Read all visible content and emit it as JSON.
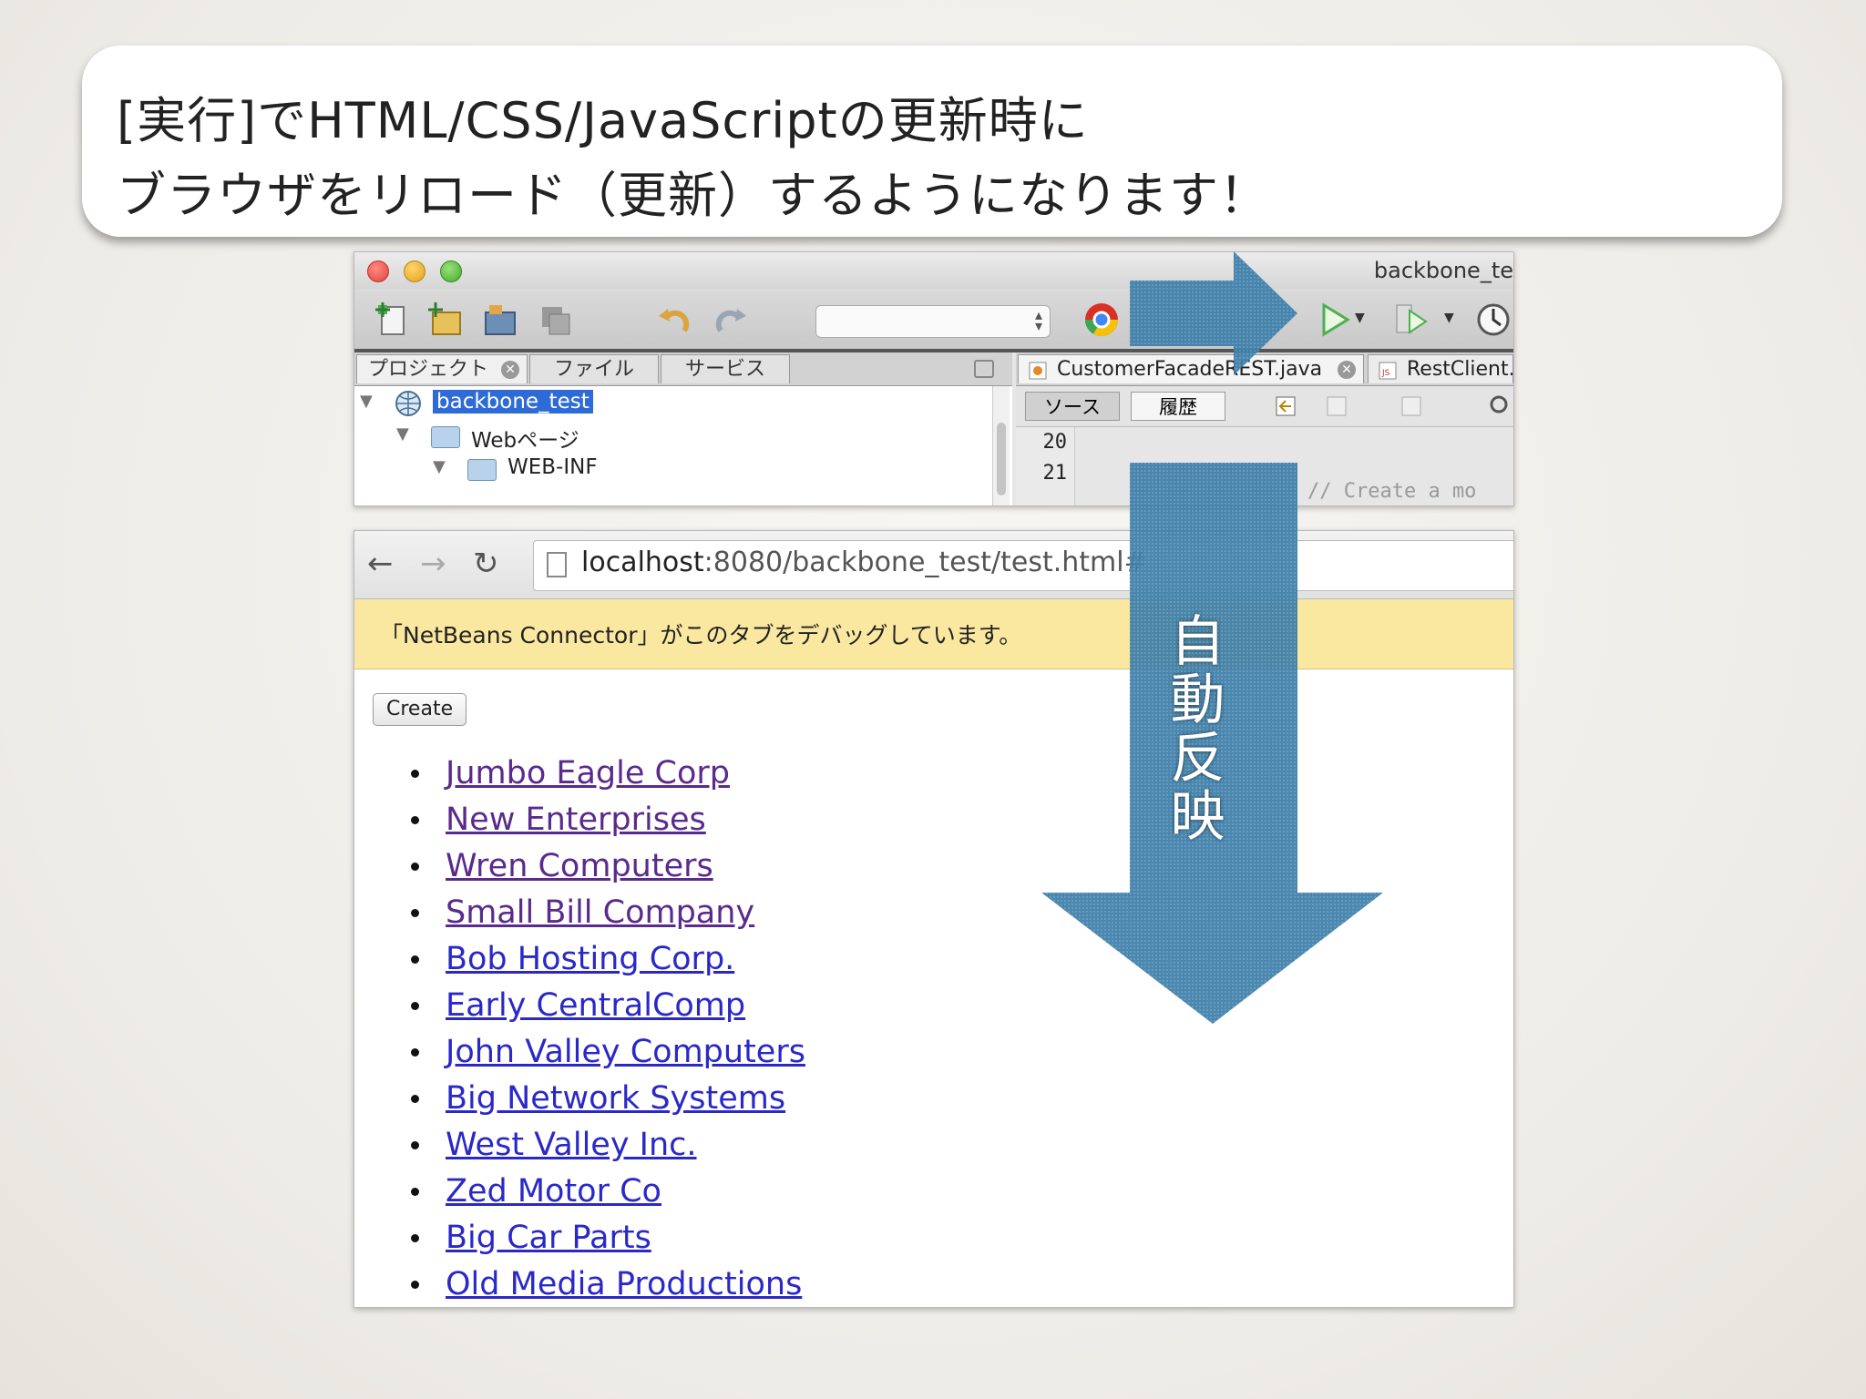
{
  "callout": {
    "line1": "[実行]でHTML/CSS/JavaScriptの更新時に",
    "line2": "ブラウザをリロード（更新）するようになります！"
  },
  "ide": {
    "window_title": "backbone_te",
    "panel_tabs": [
      "プロジェクト",
      "ファイル",
      "サービス"
    ],
    "tree": {
      "project": "backbone_test",
      "web_pages": "Webページ",
      "web_inf": "WEB-INF"
    },
    "editor_tabs": [
      "CustomerFacadeREST.java",
      "RestClient.j"
    ],
    "source_button": "ソース",
    "history_button": "履歴",
    "line_numbers": [
      "20",
      "21"
    ],
    "code_line": "// Create a mo"
  },
  "browser": {
    "url_host": "localhost",
    "url_rest": ":8080/backbone_test/test.html#",
    "infobar_text": "「NetBeans Connector」がこのタブをデバッグしています。",
    "create_button": "Create",
    "items": [
      "Jumbo Eagle Corp",
      "New Enterprises",
      "Wren Computers",
      "Small Bill Company",
      "Bob Hosting Corp.",
      "Early CentralComp",
      "John Valley Computers",
      "Big Network Systems",
      "West Valley Inc.",
      "Zed Motor Co",
      "Big Car Parts",
      "Old Media Productions"
    ]
  },
  "annotation": {
    "vertical_label": "自動反映"
  },
  "colors": {
    "arrow": "#3d7ea8",
    "link": "#2a29c8",
    "visited_link": "#5a2a8c",
    "infobar": "#fbe8a0"
  }
}
